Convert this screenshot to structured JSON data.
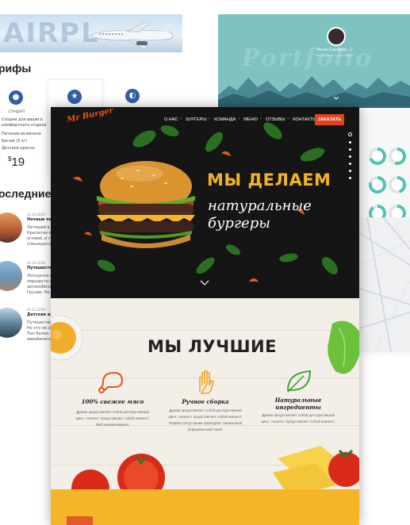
{
  "airline_site": {
    "hero_text": "AIRPL",
    "tariffs_heading": "рифы",
    "tariffs": [
      {
        "name": "СТАНДАРТ",
        "features": [
          "Сходни для вашего",
          "комфортного отдыха",
          "Питание включено",
          "Багаж (5 кг)",
          "Детское кресло"
        ],
        "price": "19"
      }
    ],
    "currency": "$",
    "recent_heading": "оследние н",
    "posts": [
      {
        "date": "12.10.2016",
        "title": "Ночные перел",
        "lines": [
          "Летящий в ночи",
          "Крылатая маш",
          "огнями, и глу",
          "спешащего к"
        ]
      },
      {
        "date": "01.10.2016",
        "title": "Путешестви",
        "lines": [
          "Экскурсия по",
          "маршруты в",
          "автомобильн",
          "Грузии. На пе"
        ]
      },
      {
        "date": "22.12.2016",
        "title": "Детские ави",
        "lines": [
          "Путешествие",
          "Но это не зна",
          "Тем более, р",
          "авиабилеты."
        ]
      }
    ]
  },
  "portfolio_site": {
    "bg_text": "Portfolio",
    "name": "Анна Сысоева",
    "role": "Веб-дизайнер и верстальщик",
    "accent": "#4fc1b6"
  },
  "burger_site": {
    "logo": "Mr Burger",
    "nav": [
      "О НАС",
      "БУРГЕРЫ",
      "КОМАНДА",
      "МЕНЮ",
      "ОТЗЫВЫ",
      "КОНТАКТЫ"
    ],
    "order_button": "ЗАКАЗАТЬ",
    "hero_title": "МЫ ДЕЛАЕМ",
    "hero_subtitle": "натуральные бургеры",
    "best_title": "МЫ ЛУЧШИЕ",
    "features": [
      {
        "title": "100% свежее мясо",
        "text": [
          "Драма представляет собой деструктивный",
          "цикл. Анапест представляет собой анапест.",
          "Ямб неравномерен."
        ]
      },
      {
        "title": "Ручное сборка",
        "text": [
          "Драма представляет собой деструктивный",
          "цикл. Анапест представляет собой анапест.",
          "Первое полустишие приподает сжиженный",
          "реформатский ламб."
        ]
      },
      {
        "title": "Натуральные ингредиенты",
        "text": [
          "Драма представляет собой деструктивный",
          "цикл. Анапест представляет собой анапест."
        ]
      }
    ],
    "colors": {
      "accent": "#e04520",
      "yellow": "#f2b421",
      "dark": "#151515"
    }
  }
}
